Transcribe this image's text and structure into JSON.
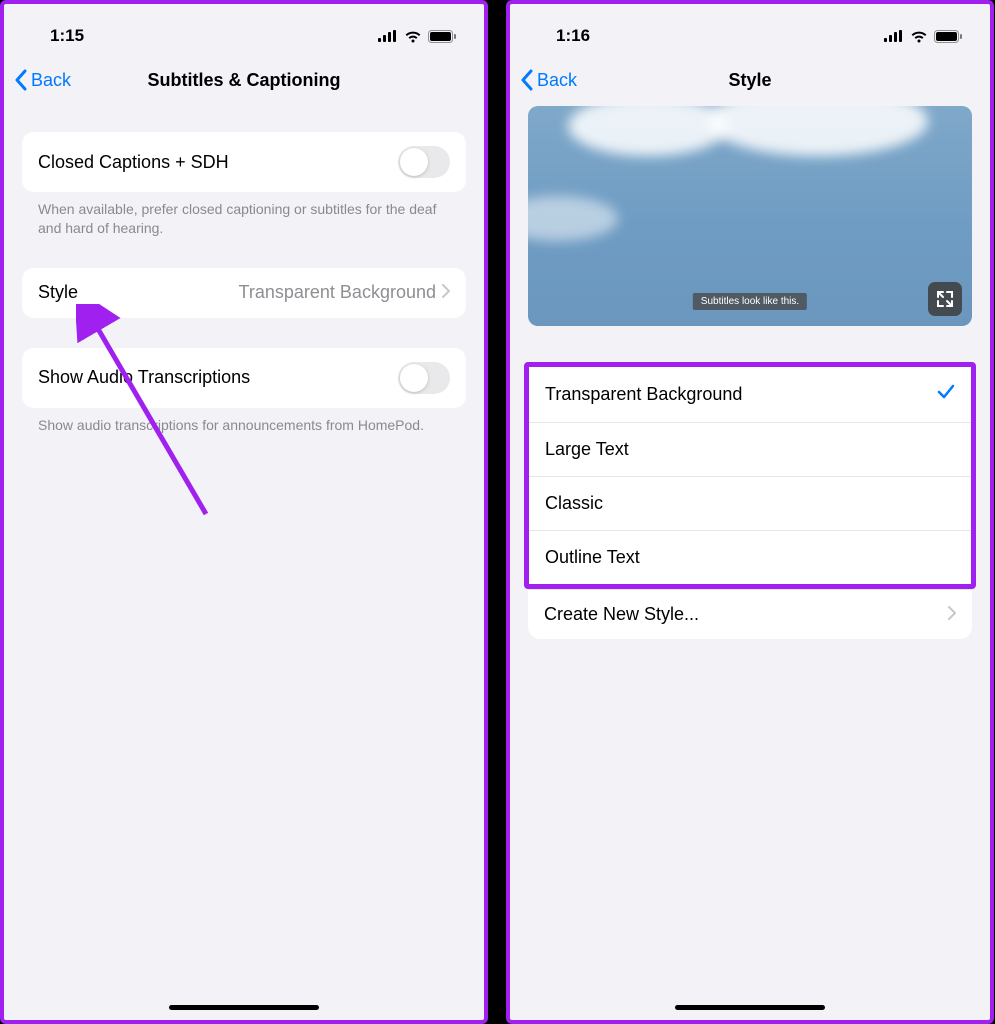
{
  "left": {
    "status": {
      "time": "1:15"
    },
    "nav": {
      "back": "Back",
      "title": "Subtitles & Captioning"
    },
    "rows": {
      "cc_sdh": "Closed Captions + SDH",
      "cc_sdh_footer": "When available, prefer closed captioning or subtitles for the deaf and hard of hearing.",
      "style_label": "Style",
      "style_value": "Transparent Background",
      "audio_trans": "Show Audio Transcriptions",
      "audio_trans_footer": "Show audio transcriptions for announcements from HomePod."
    }
  },
  "right": {
    "status": {
      "time": "1:16"
    },
    "nav": {
      "back": "Back",
      "title": "Style"
    },
    "preview_subtitle": "Subtitles look like this.",
    "styles": [
      {
        "label": "Transparent Background",
        "selected": true
      },
      {
        "label": "Large Text",
        "selected": false
      },
      {
        "label": "Classic",
        "selected": false
      },
      {
        "label": "Outline Text",
        "selected": false
      }
    ],
    "create_new": "Create New Style..."
  }
}
